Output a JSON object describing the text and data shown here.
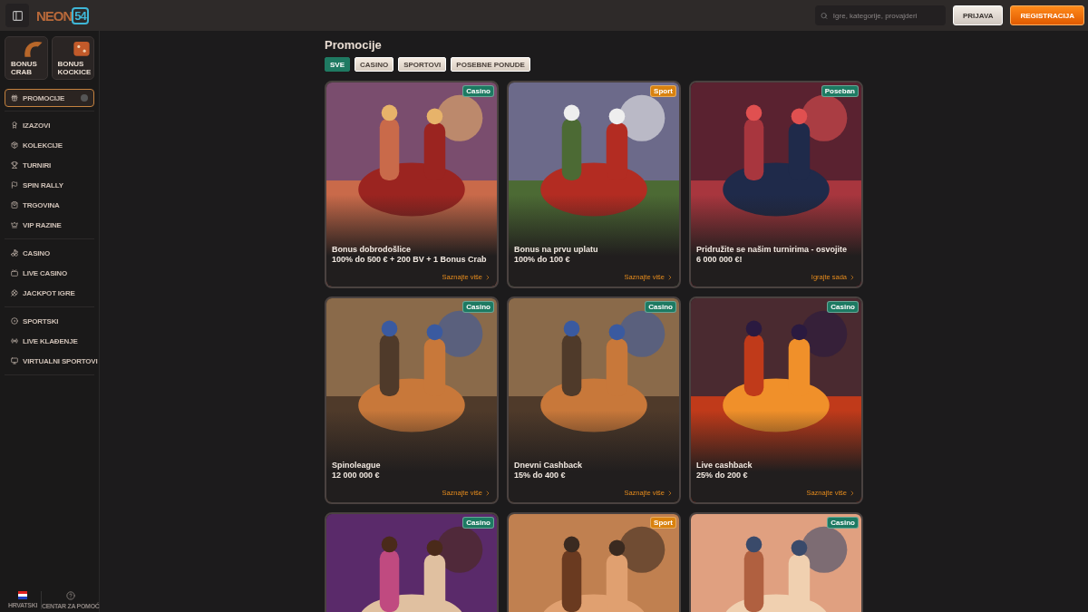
{
  "header": {
    "logo": {
      "word": "NEON",
      "number": "54"
    },
    "search": {
      "placeholder": "Igre, kategorije, provajderi"
    },
    "buttons": [
      {
        "label": "PRIJAVA",
        "kind": "login"
      },
      {
        "label": "REGISTRACIJA",
        "kind": "register"
      }
    ]
  },
  "sidebar": {
    "bonus_tiles": [
      {
        "label": "BONUS CRAB",
        "kind": "crab"
      },
      {
        "label": "BONUS KOCKICE",
        "kind": "dice"
      }
    ],
    "groups": [
      [
        {
          "label": "PROMOCIJE",
          "selected": true
        }
      ],
      [
        {
          "label": "IZAZOVI",
          "selected": false
        },
        {
          "label": "KOLEKCIJE",
          "selected": false
        },
        {
          "label": "TURNIRI",
          "selected": false
        },
        {
          "label": "SPIN RALLY",
          "selected": false
        },
        {
          "label": "TRGOVINA",
          "selected": false
        },
        {
          "label": "VIP RAZINE",
          "selected": false
        }
      ],
      [
        {
          "label": "CASINO",
          "selected": false
        },
        {
          "label": "LIVE CASINO",
          "selected": false
        },
        {
          "label": "JACKPOT IGRE",
          "selected": false
        }
      ],
      [
        {
          "label": "SPORTSKI",
          "selected": false
        },
        {
          "label": "LIVE KLAĐENJE",
          "selected": false
        },
        {
          "label": "VIRTUALNI SPORTOVI",
          "selected": false
        }
      ]
    ],
    "footer": [
      {
        "label": "HRVATSKI",
        "kind": "flag"
      },
      {
        "label": "CENTAR ZA POMOĆ",
        "kind": "help"
      }
    ]
  },
  "main": {
    "title": "Promocije",
    "filters": [
      {
        "label": "SVE",
        "selected": true
      },
      {
        "label": "CASINO",
        "selected": false
      },
      {
        "label": "SPORTOVI",
        "selected": false
      },
      {
        "label": "POSEBNE PONUDE",
        "selected": false
      }
    ],
    "promotions": [
      {
        "tag": "Casino",
        "color": "#1d7a62",
        "title": "Bonus dobrodošlice",
        "subtitle": "100% do 500 € + 200 BV + 1 Bonus Crab",
        "link": "Saznajte više"
      },
      {
        "tag": "Sport",
        "color": "#d9820f",
        "title": "Bonus na prvu uplatu",
        "subtitle": "100% do 100 €",
        "link": "Saznajte više"
      },
      {
        "tag": "Poseban",
        "color": "#1d7a62",
        "title": "Pridružite se našim turnirima - osvojite",
        "subtitle": "6 000 000 €!",
        "link": "Igrajte sada"
      },
      {
        "tag": "Casino",
        "color": "#1d7a62",
        "title": "Spinoleague",
        "subtitle": "12 000 000 €",
        "link": "Saznajte više"
      },
      {
        "tag": "Casino",
        "color": "#1d7a62",
        "title": "Dnevni Cashback",
        "subtitle": "15% do 400 €",
        "link": "Saznajte više"
      },
      {
        "tag": "Casino",
        "color": "#1d7a62",
        "title": "Live cashback",
        "subtitle": "25% do 200 €",
        "link": "Saznajte više"
      },
      {
        "tag": "Casino",
        "color": "#1d7a62"
      },
      {
        "tag": "Sport",
        "color": "#d9820f"
      },
      {
        "tag": "Casino",
        "color": "#1d7a62"
      }
    ]
  }
}
